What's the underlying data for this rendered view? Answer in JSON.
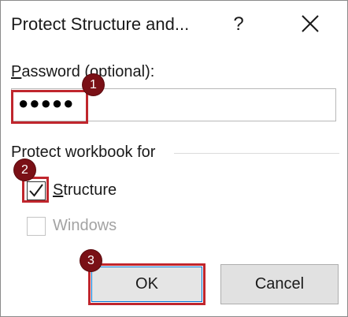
{
  "dialog": {
    "title": "Protect Structure and...",
    "help_label": "?",
    "close_icon": "close-icon"
  },
  "password": {
    "label_accel": "P",
    "label_rest": "assword (optional):",
    "value": "●●●●●"
  },
  "group": {
    "label": "Protect workbook for"
  },
  "options": {
    "structure": {
      "accel": "S",
      "rest": "tructure",
      "checked": true,
      "enabled": true
    },
    "windows": {
      "label": "Windows",
      "checked": false,
      "enabled": false
    }
  },
  "buttons": {
    "ok": "OK",
    "cancel": "Cancel"
  },
  "annotations": {
    "step1": "1",
    "step2": "2",
    "step3": "3",
    "highlight_color": "#c0262d",
    "badge_color": "#7a1016"
  }
}
